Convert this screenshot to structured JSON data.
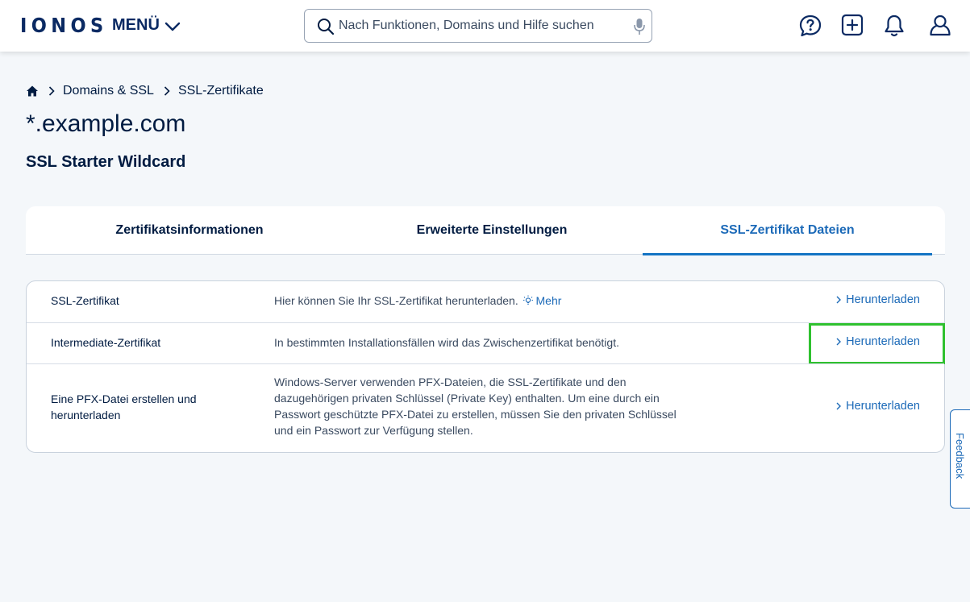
{
  "header": {
    "logo": "IONOS",
    "menu_label": "MENÜ",
    "search_placeholder": "Nach Funktionen, Domains und Hilfe suchen",
    "icons": [
      "help-chat-icon",
      "add-icon",
      "bell-icon",
      "user-icon"
    ]
  },
  "breadcrumb": {
    "home_icon": "home-icon",
    "items": [
      "Domains & SSL",
      "SSL-Zertifikate"
    ]
  },
  "page": {
    "title": "*.example.com",
    "subtitle": "SSL Starter Wildcard"
  },
  "tabs": [
    {
      "label": "Zertifikatsinformationen",
      "active": false
    },
    {
      "label": "Erweiterte Einstellungen",
      "active": false
    },
    {
      "label": "SSL-Zertifikat Dateien",
      "active": true
    }
  ],
  "files": [
    {
      "label": "SSL-Zertifikat",
      "description": "Hier können Sie Ihr SSL-Zertifikat herunterladen.",
      "more_label": "Mehr",
      "action": "Herunterladen"
    },
    {
      "label": "Intermediate-Zertifikat",
      "description": "In bestimmten Installationsfällen wird das Zwischenzertifikat benötigt.",
      "action": "Herunterladen"
    },
    {
      "label_lines": [
        "Eine PFX-Datei erstellen und",
        "herunterladen"
      ],
      "description_lines": [
        "Windows-Server verwenden PFX-Dateien, die SSL-Zertifikate und den",
        "dazugehörigen privaten Schlüssel (Private Key) enthalten. Um eine durch ein",
        "Passwort geschützte PFX-Datei zu erstellen, müssen Sie den privaten Schlüssel",
        "und ein Passwort zur Verfügung stellen."
      ],
      "action": "Herunterladen"
    }
  ],
  "feedback_label": "Feedback",
  "colors": {
    "brand": "#0b2a63",
    "link": "#1c6ab8",
    "highlight": "#2fc12f",
    "background": "#f4f7fa"
  }
}
